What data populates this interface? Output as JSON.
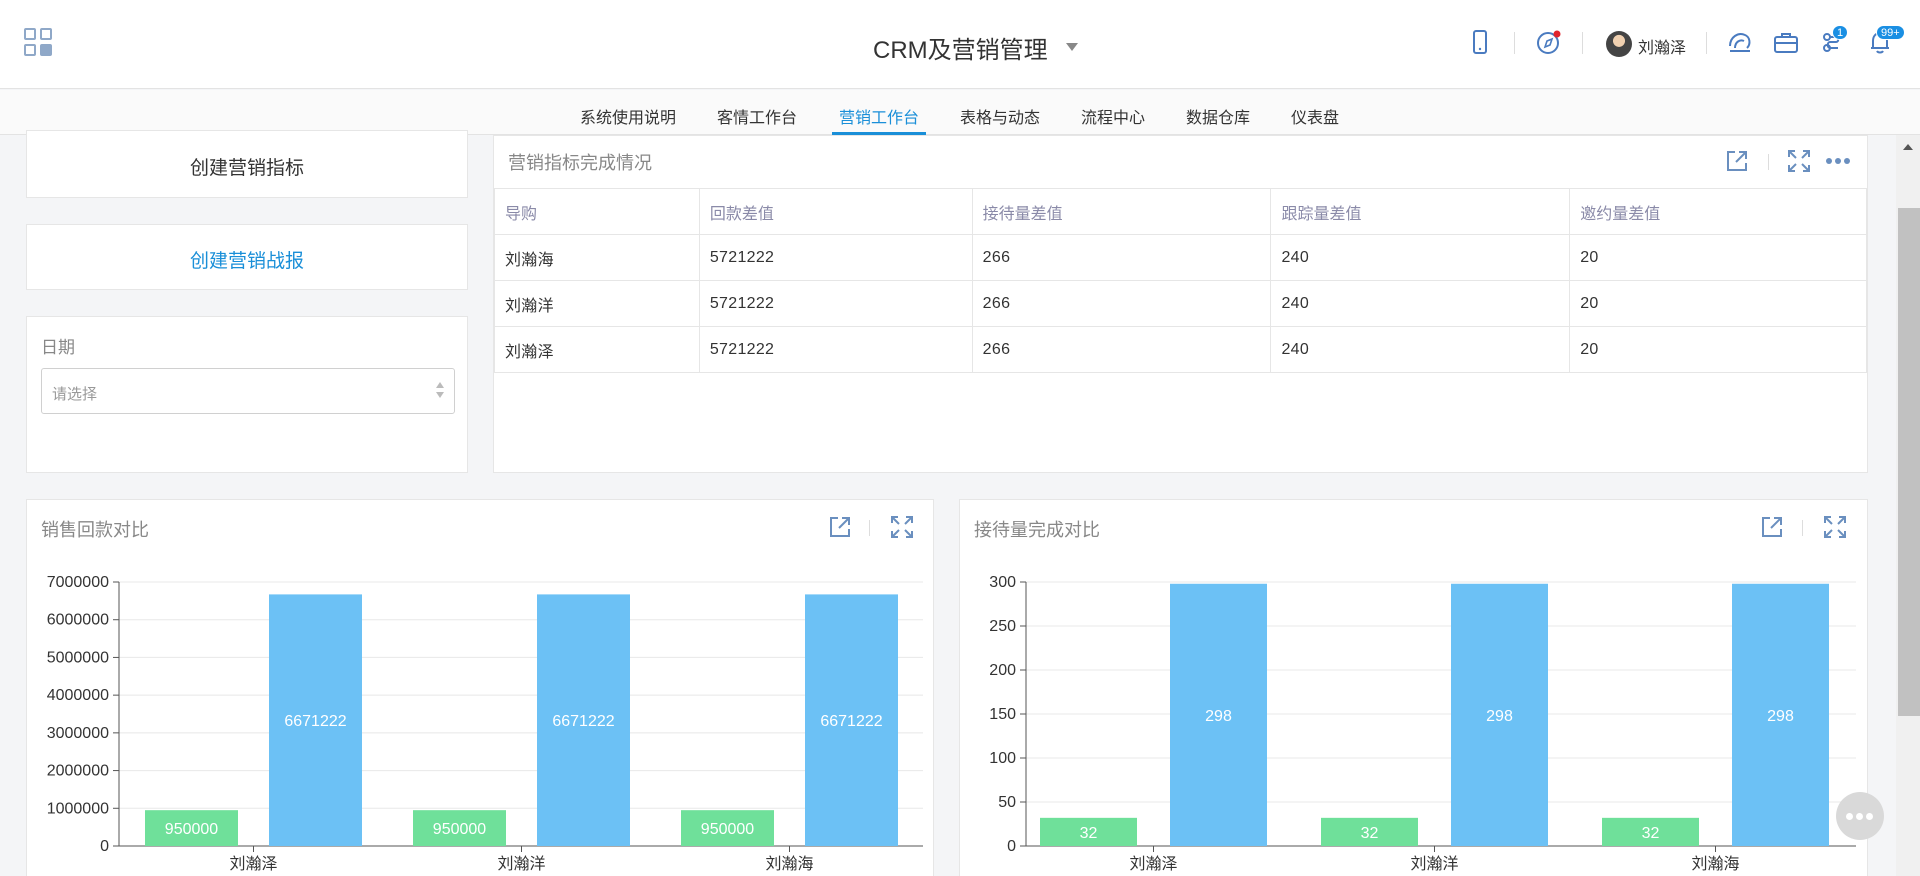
{
  "header": {
    "app_title": "CRM及营销管理",
    "username": "刘瀚泽",
    "briefcase_badge": "1",
    "bell_badge": "99+"
  },
  "nav": {
    "tabs": [
      {
        "label": "系统使用说明"
      },
      {
        "label": "客情工作台"
      },
      {
        "label": "营销工作台"
      },
      {
        "label": "表格与动态"
      },
      {
        "label": "流程中心"
      },
      {
        "label": "数据仓库"
      },
      {
        "label": "仪表盘"
      }
    ],
    "active_index": 2
  },
  "left": {
    "create_target_label": "创建营销指标",
    "create_report_label": "创建营销战报",
    "date_label": "日期",
    "date_placeholder": "请选择"
  },
  "target_panel": {
    "title": "营销指标完成情况",
    "columns": [
      "导购",
      "回款差值",
      "接待量差值",
      "跟踪量差值",
      "邀约量差值"
    ],
    "rows": [
      [
        "刘瀚海",
        "5721222",
        "266",
        "240",
        "20"
      ],
      [
        "刘瀚洋",
        "5721222",
        "266",
        "240",
        "20"
      ],
      [
        "刘瀚泽",
        "5721222",
        "266",
        "240",
        "20"
      ]
    ]
  },
  "colors": {
    "accent": "#1a8fd8",
    "bar_green": "#6fe09a",
    "bar_blue": "#6cc1f5"
  },
  "chart_data": [
    {
      "type": "bar",
      "title": "销售回款对比",
      "categories": [
        "刘瀚泽",
        "刘瀚洋",
        "刘瀚海"
      ],
      "series": [
        {
          "values": [
            950000,
            950000,
            950000
          ],
          "color": "#6fe09a"
        },
        {
          "values": [
            6671222,
            6671222,
            6671222
          ],
          "color": "#6cc1f5"
        }
      ],
      "yticks": [
        "0",
        "1000000",
        "2000000",
        "3000000",
        "4000000",
        "5000000",
        "6000000",
        "7000000"
      ],
      "ylim": [
        0,
        7000000
      ],
      "grid": true
    },
    {
      "type": "bar",
      "title": "接待量完成对比",
      "categories": [
        "刘瀚泽",
        "刘瀚洋",
        "刘瀚海"
      ],
      "series": [
        {
          "values": [
            32,
            32,
            32
          ],
          "color": "#6fe09a"
        },
        {
          "values": [
            298,
            298,
            298
          ],
          "color": "#6cc1f5"
        }
      ],
      "yticks": [
        "0",
        "50",
        "100",
        "150",
        "200",
        "250",
        "300"
      ],
      "ylim": [
        0,
        300
      ],
      "grid": true
    }
  ]
}
